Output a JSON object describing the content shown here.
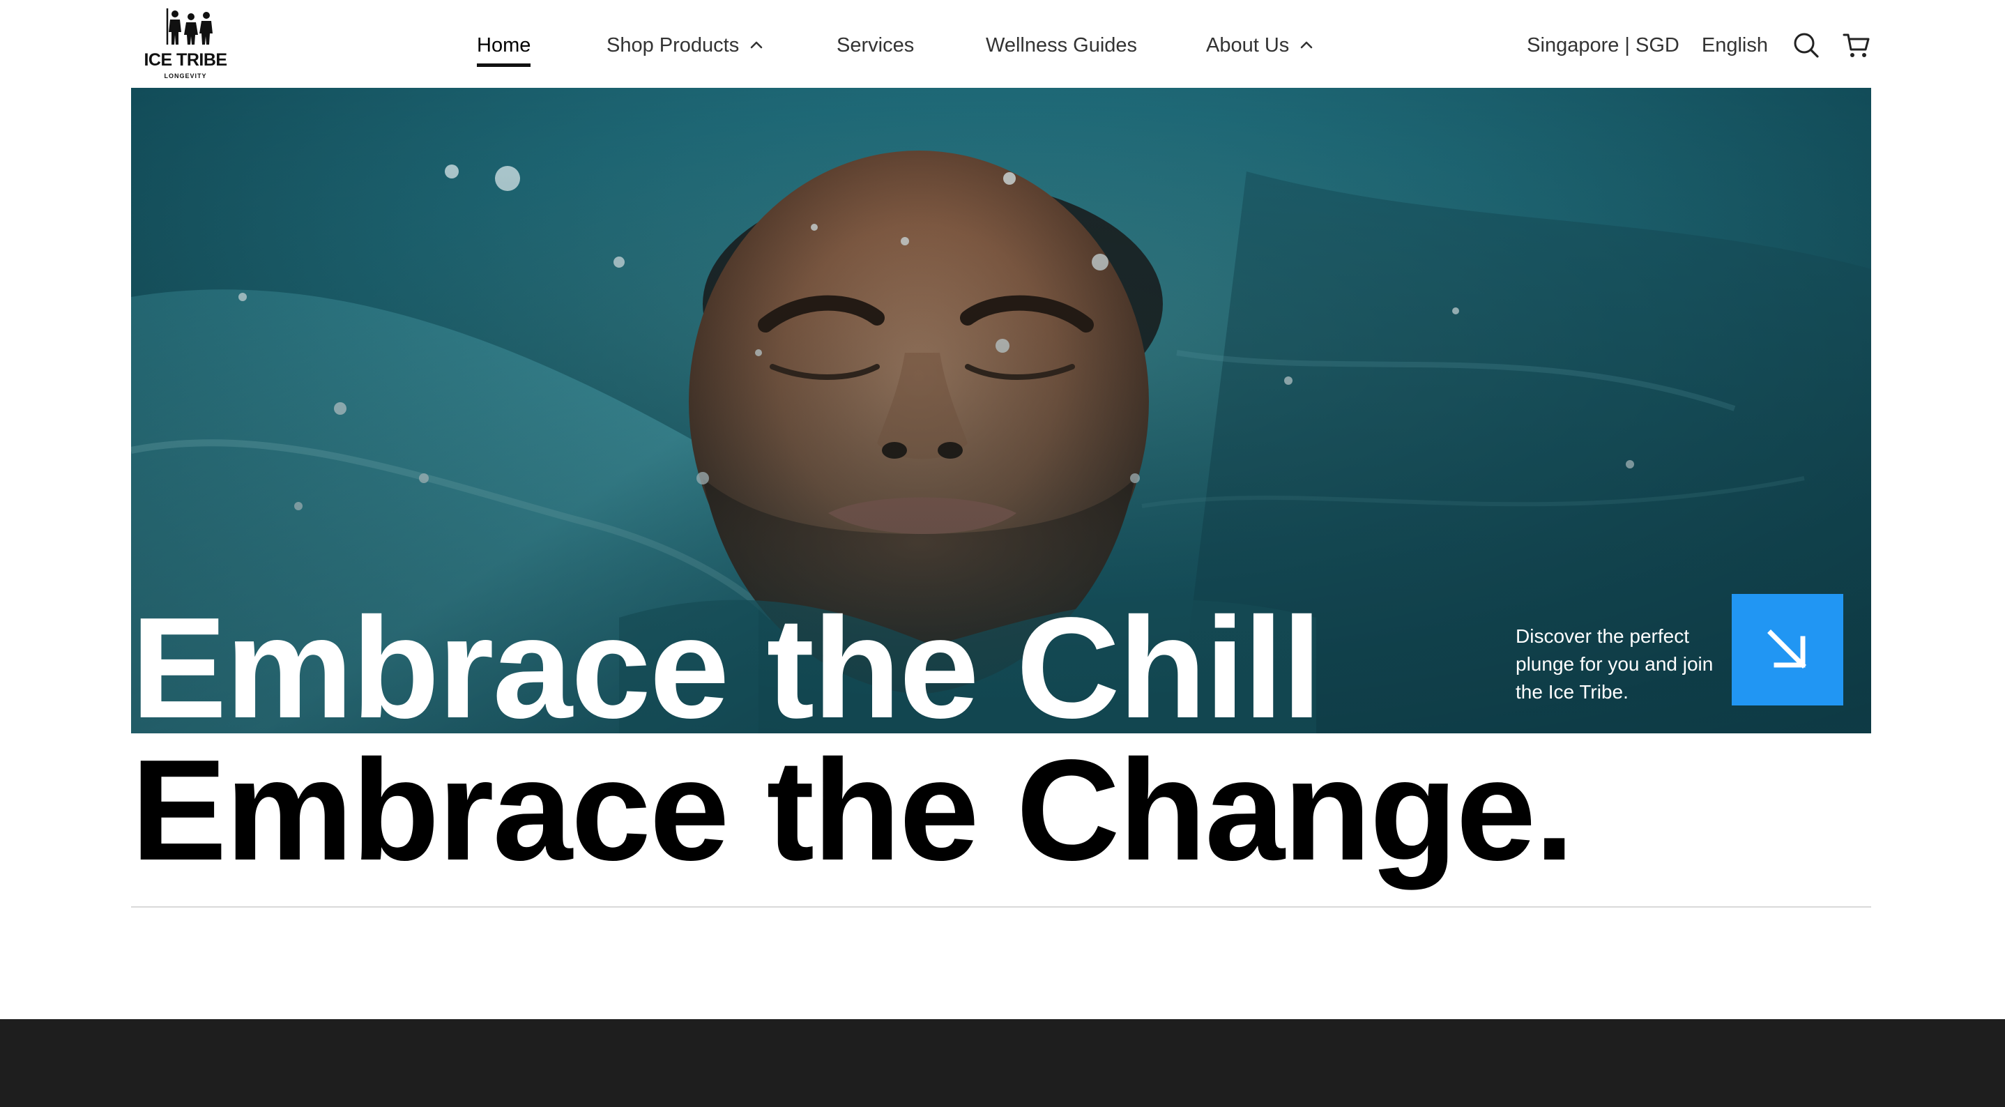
{
  "header": {
    "logo": {
      "brand": "ICE TRIBE",
      "tagline": "LONGEVITY",
      "icon": "tribe-figures-logo"
    },
    "nav": [
      {
        "label": "Home",
        "active": true,
        "has_dropdown": false
      },
      {
        "label": "Shop Products",
        "active": false,
        "has_dropdown": true,
        "dropdown_icon": "chevron-up-icon"
      },
      {
        "label": "Services",
        "active": false,
        "has_dropdown": false
      },
      {
        "label": "Wellness Guides",
        "active": false,
        "has_dropdown": false
      },
      {
        "label": "About Us",
        "active": false,
        "has_dropdown": true,
        "dropdown_icon": "chevron-up-icon"
      }
    ],
    "utilities": {
      "region": "Singapore | SGD",
      "language": "English",
      "search_icon": "search-icon",
      "cart_icon": "cart-icon"
    }
  },
  "hero": {
    "image": "man-floating-in-ice-water-photo",
    "headline_line1": "Embrace the Chill",
    "headline_line2": "Embrace the Change.",
    "cta_text": "Discover the perfect plunge for you and join the Ice Tribe.",
    "cta_icon": "arrow-down-right-icon"
  },
  "colors": {
    "accent": "#2196f3",
    "text_dark": "#000000",
    "text_light": "#ffffff",
    "footer": "#1e1e1e",
    "divider": "#d9d9d9"
  }
}
